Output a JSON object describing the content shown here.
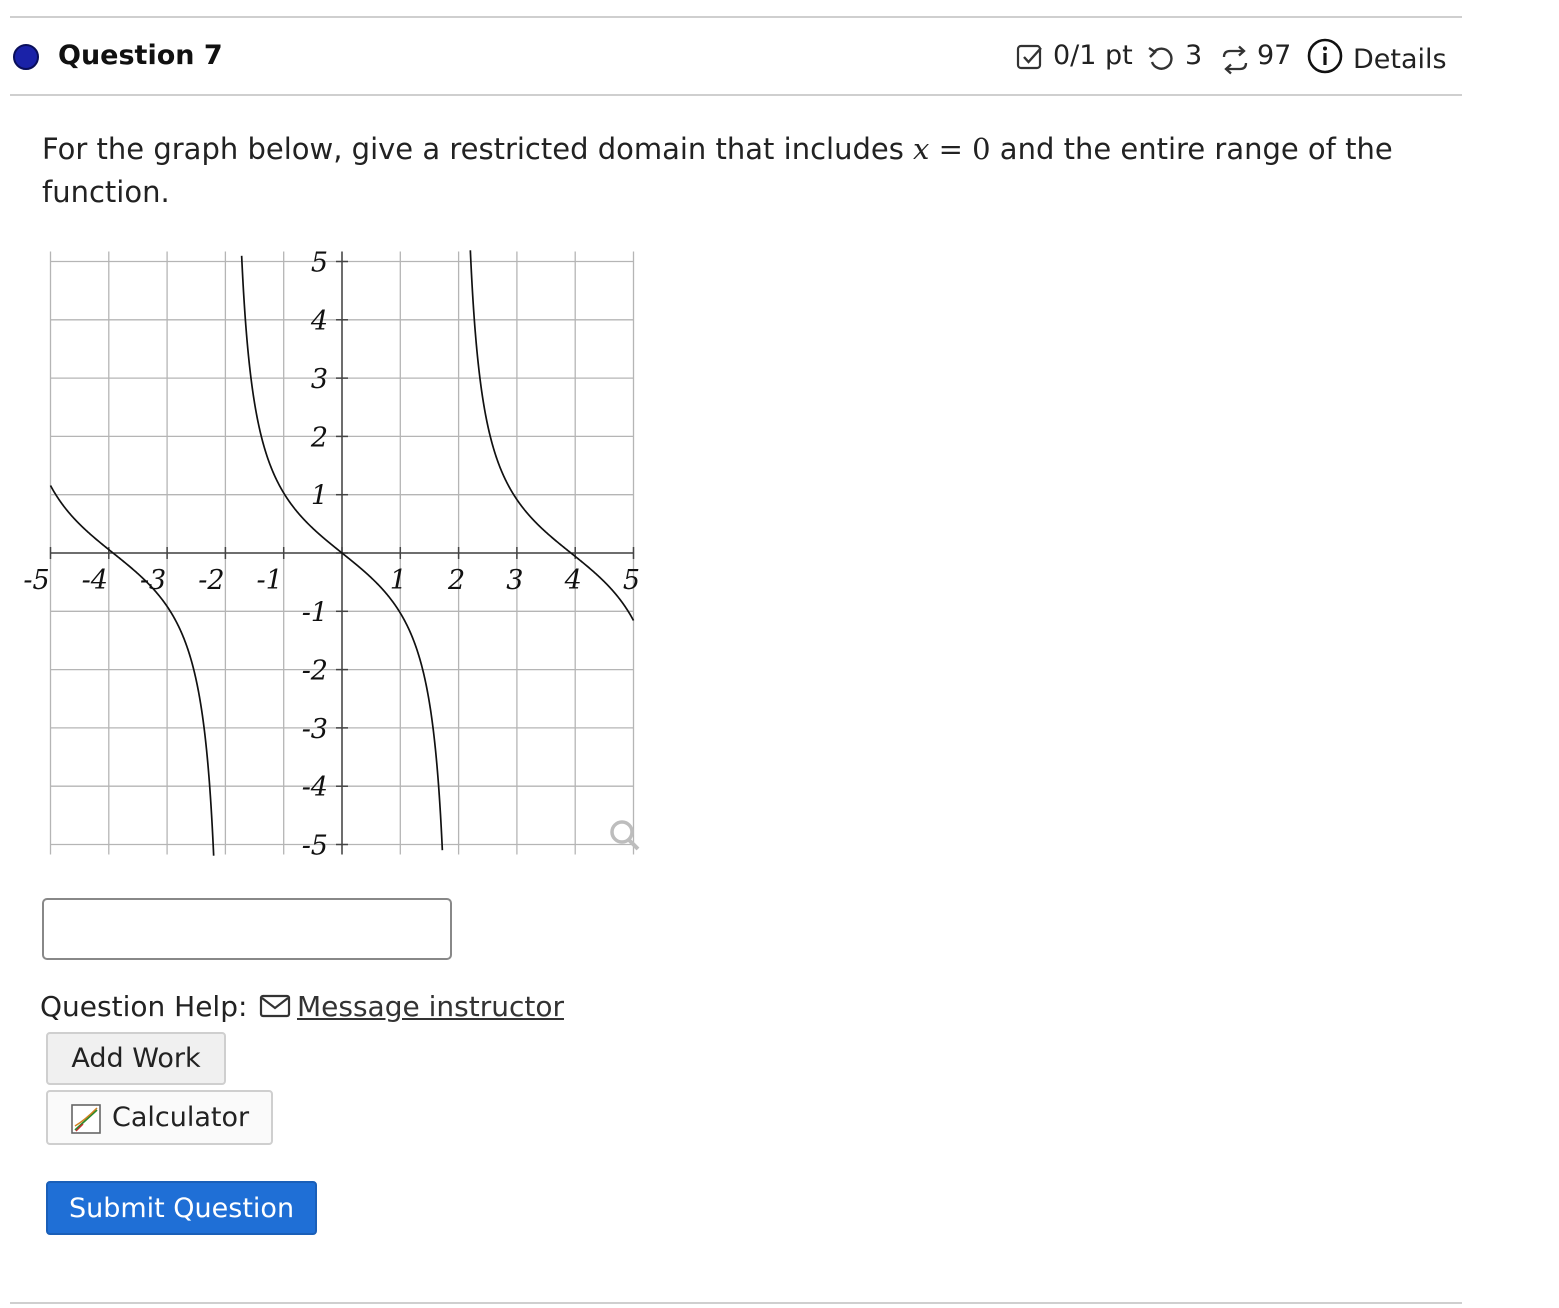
{
  "header": {
    "question_title": "Question 7",
    "score": "0/1 pt",
    "retries": "3",
    "attempts": "97",
    "details_label": "Details",
    "status_color": "#1a22a8"
  },
  "prompt": {
    "before": "For the graph below, give a restricted domain that includes ",
    "math_var": "x",
    "math_eq": " = 0",
    "after": " and the entire range of the function."
  },
  "chart_data": {
    "type": "line",
    "function": "y = -tan(x/1.25)",
    "x_ticks": [
      "-5",
      "-4",
      "-3",
      "-2",
      "-1",
      "1",
      "2",
      "3",
      "4",
      "5"
    ],
    "y_ticks": [
      "5",
      "4",
      "3",
      "2",
      "1",
      "-1",
      "-2",
      "-3",
      "-4",
      "-5"
    ],
    "xlim": [
      -5,
      5
    ],
    "ylim": [
      -5,
      5
    ],
    "grid": true,
    "asymptotes_x": [
      -1.9635,
      1.9635
    ],
    "zeros_x": [
      -3.927,
      0,
      3.927
    ],
    "zoom_icon": "magnifier-icon"
  },
  "answer": {
    "value": "",
    "placeholder": ""
  },
  "help": {
    "label": "Question Help:",
    "message_link": "Message instructor"
  },
  "buttons": {
    "add_work": "Add Work",
    "calculator": "Calculator",
    "submit": "Submit Question"
  },
  "colors": {
    "accent": "#1f6fd6",
    "grid": "#b5b5b5"
  }
}
